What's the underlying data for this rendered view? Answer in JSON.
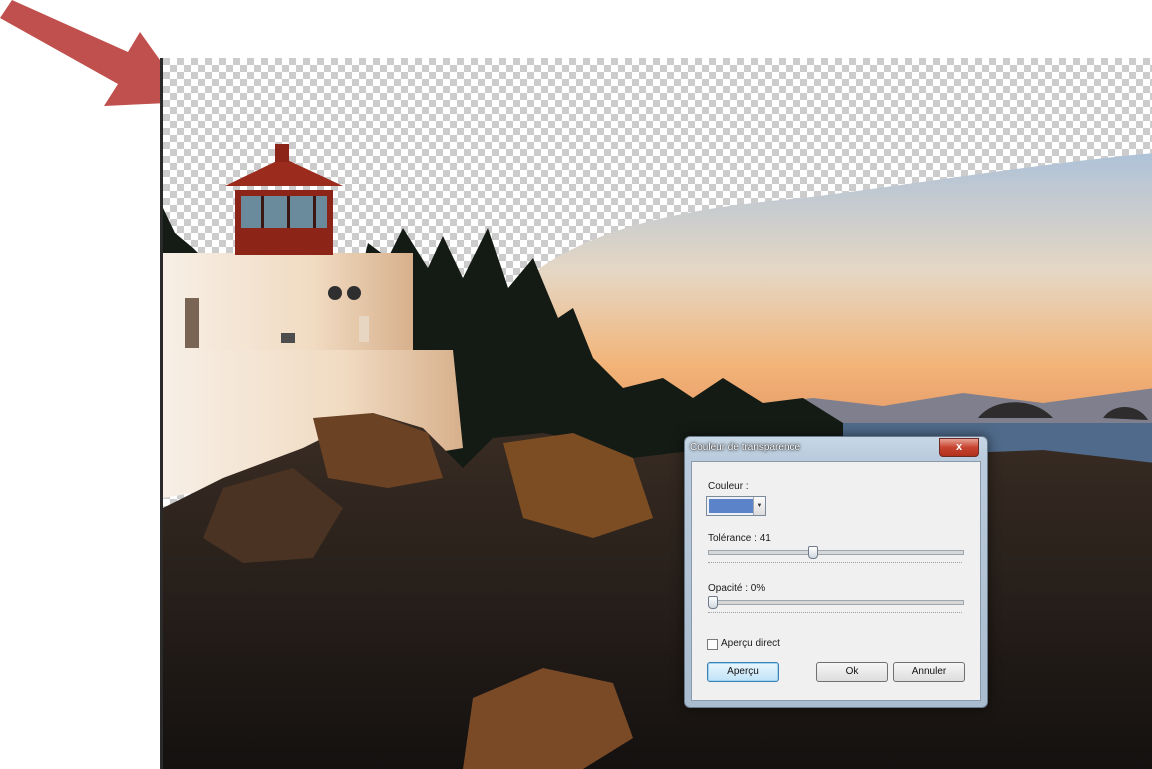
{
  "dialog": {
    "title": "Couleur de transparence",
    "close_label": "x",
    "color_label": "Couleur :",
    "color_value": "#5b83c9",
    "tolerance_label": "Tolérance : 41",
    "tolerance_value": 41,
    "opacity_label": "Opacité : 0%",
    "opacity_value": 0,
    "live_preview_label": "Aperçu direct",
    "live_preview_checked": false,
    "preview_button": "Aperçu",
    "ok_button": "Ok",
    "cancel_button": "Annuler"
  },
  "colors": {
    "arrow": "#c0504d",
    "lighthouse_roof": "#8c2418",
    "sky_top": "#aec2d8",
    "sky_bottom": "#f0a86a"
  }
}
